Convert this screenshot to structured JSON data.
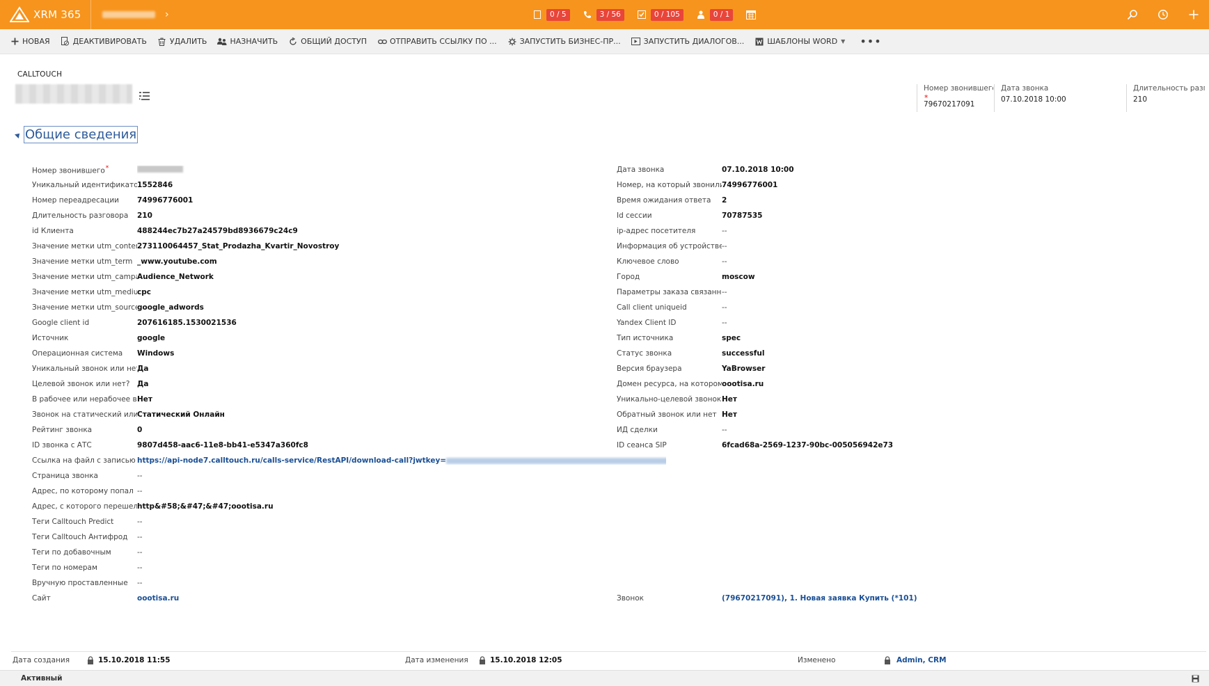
{
  "topbar": {
    "app_name": "XRM 365",
    "counters": [
      {
        "icon": "document-icon",
        "value": "0 / 5"
      },
      {
        "icon": "phone-icon",
        "value": "3 / 56"
      },
      {
        "icon": "task-icon",
        "value": "0 / 105"
      },
      {
        "icon": "person-icon",
        "value": "0 / 1"
      }
    ],
    "right_icons": [
      "search-icon",
      "history-icon",
      "plus-icon"
    ]
  },
  "commands": [
    {
      "label": "НОВАЯ",
      "icon": "plus-icon"
    },
    {
      "label": "ДЕАКТИВИРОВАТЬ",
      "icon": "deactivate-icon"
    },
    {
      "label": "УДАЛИТЬ",
      "icon": "trash-icon"
    },
    {
      "label": "НАЗНАЧИТЬ",
      "icon": "assign-icon"
    },
    {
      "label": "ОБЩИЙ ДОСТУП",
      "icon": "share-icon"
    },
    {
      "label": "ОТПРАВИТЬ ССЫЛКУ ПО ...",
      "icon": "link-icon"
    },
    {
      "label": "ЗАПУСТИТЬ БИЗНЕС-ПР...",
      "icon": "workflow-icon"
    },
    {
      "label": "ЗАПУСТИТЬ ДИАЛОГОВ...",
      "icon": "dialog-icon"
    },
    {
      "label": "ШАБЛОНЫ WORD",
      "icon": "word-icon"
    }
  ],
  "header": {
    "entity_type": "CALLTOUCH",
    "fields": [
      {
        "label": "Номер звонившего",
        "value": "79670217091",
        "required": true
      },
      {
        "label": "Дата звонка",
        "value": "07.10.2018   10:00"
      },
      {
        "label": "Длительность разговора",
        "value": "210"
      }
    ]
  },
  "section": {
    "title": "Общие сведения"
  },
  "left_fields": [
    {
      "label": "Номер звонившего",
      "value": "",
      "required": true,
      "blurred": true
    },
    {
      "label": "Уникальный идентификатор",
      "value": "1552846"
    },
    {
      "label": "Номер переадресации",
      "value": "74996776001"
    },
    {
      "label": "Длительность разговора",
      "value": "210"
    },
    {
      "label": "id Клиента",
      "value": "488244ec7b27a24579bd8936679c24c9"
    },
    {
      "label": "Значение метки utm_content",
      "value": "273110064457_Stat_Prodazha_Kvartir_Novostroy"
    },
    {
      "label": "Значение метки utm_term",
      "value": "_www.youtube.com"
    },
    {
      "label": "Значение метки utm_campaign",
      "value": "Audience_Network"
    },
    {
      "label": "Значение метки utm_medium",
      "value": "cpc"
    },
    {
      "label": "Значение метки utm_source",
      "value": "google_adwords"
    },
    {
      "label": "Google client id",
      "value": "207616185.1530021536"
    },
    {
      "label": "Источник",
      "value": "google"
    },
    {
      "label": "Операционная система",
      "value": "Windows"
    },
    {
      "label": "Уникальный звонок или нет?",
      "value": "Да"
    },
    {
      "label": "Целевой звонок или нет?",
      "value": "Да"
    },
    {
      "label": "В рабочее или нерабочее время",
      "value": "Нет"
    },
    {
      "label": "Звонок на статический или динамический",
      "value": "Статический Онлайн"
    },
    {
      "label": "Рейтинг звонка",
      "value": "0"
    },
    {
      "label": "ID звонка с АТС",
      "value": "9807d458-aac6-11e8-bb41-e5347a360fc8"
    },
    {
      "label": "Ссылка на файл с записью",
      "value": "https://api-node7.calltouch.ru/calls-service/RestAPI/download-call?jwtkey=",
      "link": true,
      "blur_tail": true
    },
    {
      "label": "Страница звонка",
      "value": "--",
      "empty": true
    },
    {
      "label": "Адрес, по которому попал",
      "value": "--",
      "empty": true
    },
    {
      "label": "Адрес, с которого перешел",
      "value": "http&#58;&#47;&#47;oootisa.ru"
    },
    {
      "label": "Теги Calltouch Predict",
      "value": "--",
      "empty": true
    },
    {
      "label": "Теги Calltouch Антифрод",
      "value": "--",
      "empty": true
    },
    {
      "label": "Теги по добавочным",
      "value": "--",
      "empty": true
    },
    {
      "label": "Теги по номерам",
      "value": "--",
      "empty": true
    },
    {
      "label": "Вручную проставленные",
      "value": "--",
      "empty": true
    },
    {
      "label": "Сайт",
      "value": "oootisa.ru",
      "link": true
    }
  ],
  "right_fields": [
    {
      "label": "Дата звонка",
      "value": "07.10.2018   10:00"
    },
    {
      "label": "Номер, на который звонили",
      "value": "74996776001"
    },
    {
      "label": "Время ожидания ответа",
      "value": "2"
    },
    {
      "label": "Id сессии",
      "value": "70787535"
    },
    {
      "label": "ip-адрес посетителя",
      "value": "--",
      "empty": true
    },
    {
      "label": "Информация об устройстве",
      "value": "--",
      "empty": true
    },
    {
      "label": "Ключевое слово",
      "value": "--",
      "empty": true
    },
    {
      "label": "Город",
      "value": "moscow"
    },
    {
      "label": "Параметры заказа связанные",
      "value": "--",
      "empty": true
    },
    {
      "label": "Call client uniqueid",
      "value": "--",
      "empty": true
    },
    {
      "label": "Yandex Client ID",
      "value": "--",
      "empty": true
    },
    {
      "label": "Тип источника",
      "value": "spec"
    },
    {
      "label": "Статус звонка",
      "value": "successful"
    },
    {
      "label": "Версия браузера",
      "value": "YaBrowser"
    },
    {
      "label": "Домен ресурса, на котором",
      "value": "oootisa.ru"
    },
    {
      "label": "Уникально-целевой звонок",
      "value": "Нет"
    },
    {
      "label": "Обратный звонок или нет",
      "value": "Нет"
    },
    {
      "label": "ИД сделки",
      "value": "--",
      "empty": true
    },
    {
      "label": "ID сеанса SIP",
      "value": "6fcad68a-2569-1237-90bc-005056942e73"
    }
  ],
  "right_bottom_field": {
    "label": "Звонок",
    "value": "(79670217091), 1. Новая заявка Купить (*101)",
    "link": true
  },
  "footer": {
    "created_label": "Дата создания",
    "created_value": "15.10.2018   11:55",
    "modified_label": "Дата изменения",
    "modified_value": "15.10.2018   12:05",
    "changed_by_label": "Изменено",
    "changed_by_value": "Admin, CRM"
  },
  "status": "Активный"
}
